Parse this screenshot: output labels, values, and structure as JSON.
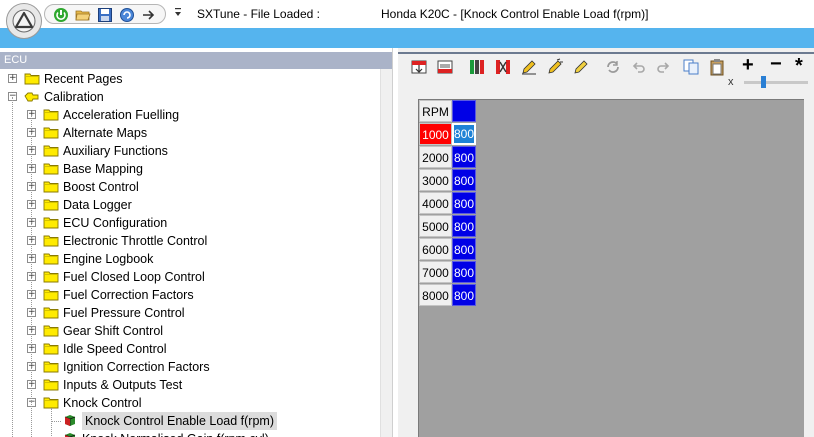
{
  "window": {
    "title_left": "SXTune - File Loaded :",
    "title_right": "Honda K20C - [Knock Control Enable Load f(rpm)]"
  },
  "quick_access": {
    "icons": [
      "power-icon",
      "open-folder-icon",
      "save-disk-icon",
      "refresh-ecu-icon",
      "arrow-right-icon"
    ],
    "dropdown_icon": "dropdown-arrow-icon"
  },
  "left_panel": {
    "header": "ECU",
    "tree": [
      {
        "label": "Recent Pages",
        "level": 0,
        "expander": "+",
        "icon": "folder-icon"
      },
      {
        "label": "Calibration",
        "level": 0,
        "expander": "-",
        "icon": "open-folder-icon"
      },
      {
        "label": "Acceleration Fuelling",
        "level": 1,
        "expander": "+",
        "icon": "folder-icon"
      },
      {
        "label": "Alternate Maps",
        "level": 1,
        "expander": "+",
        "icon": "folder-icon"
      },
      {
        "label": "Auxiliary Functions",
        "level": 1,
        "expander": "+",
        "icon": "folder-icon"
      },
      {
        "label": "Base Mapping",
        "level": 1,
        "expander": "+",
        "icon": "folder-icon"
      },
      {
        "label": "Boost Control",
        "level": 1,
        "expander": "+",
        "icon": "folder-icon"
      },
      {
        "label": "Data Logger",
        "level": 1,
        "expander": "+",
        "icon": "folder-icon"
      },
      {
        "label": "ECU Configuration",
        "level": 1,
        "expander": "+",
        "icon": "folder-icon"
      },
      {
        "label": "Electronic Throttle Control",
        "level": 1,
        "expander": "+",
        "icon": "folder-icon"
      },
      {
        "label": "Engine Logbook",
        "level": 1,
        "expander": "+",
        "icon": "folder-icon"
      },
      {
        "label": "Fuel Closed Loop Control",
        "level": 1,
        "expander": "+",
        "icon": "folder-icon"
      },
      {
        "label": "Fuel Correction Factors",
        "level": 1,
        "expander": "+",
        "icon": "folder-icon"
      },
      {
        "label": "Fuel Pressure Control",
        "level": 1,
        "expander": "+",
        "icon": "folder-icon"
      },
      {
        "label": "Gear Shift Control",
        "level": 1,
        "expander": "+",
        "icon": "folder-icon"
      },
      {
        "label": "Idle Speed Control",
        "level": 1,
        "expander": "+",
        "icon": "folder-icon"
      },
      {
        "label": "Ignition Correction Factors",
        "level": 1,
        "expander": "+",
        "icon": "folder-icon"
      },
      {
        "label": "Inputs & Outputs Test",
        "level": 1,
        "expander": "+",
        "icon": "folder-icon"
      },
      {
        "label": "Knock Control",
        "level": 1,
        "expander": "-",
        "icon": "folder-icon"
      },
      {
        "label": "Knock Control Enable Load f(rpm)",
        "level": 2,
        "expander": "",
        "icon": "table-cube-icon",
        "selected": true
      },
      {
        "label": "Knock Normalised Gain f(rpm,cyl)",
        "level": 2,
        "expander": "",
        "icon": "table-cube-icon"
      }
    ]
  },
  "toolbar": {
    "buttons": [
      "copy-up-icon",
      "copy-down-icon",
      "interpolate-columns-icon",
      "clear-columns-icon",
      "edit-cell-icon",
      "edit-selection-icon",
      "pencil-icon",
      "sync-icon",
      "undo-icon",
      "redo-icon",
      "copy-icon",
      "paste-icon"
    ],
    "plus": "+",
    "minus": "−",
    "multiply": "*",
    "zoom_x": "x"
  },
  "table": {
    "header": "RPM",
    "rows": [
      {
        "rpm": "1000",
        "value": "800"
      },
      {
        "rpm": "2000",
        "value": "800"
      },
      {
        "rpm": "3000",
        "value": "800"
      },
      {
        "rpm": "4000",
        "value": "800"
      },
      {
        "rpm": "5000",
        "value": "800"
      },
      {
        "rpm": "6000",
        "value": "800"
      },
      {
        "rpm": "7000",
        "value": "800"
      },
      {
        "rpm": "8000",
        "value": "800"
      }
    ]
  },
  "colors": {
    "ribbon": "#55b4ee",
    "value_cell": "#0000e6",
    "selected_rpm": "#ff0000",
    "selected_value": "#1e82d6",
    "tree_header": "#aab3c8"
  }
}
